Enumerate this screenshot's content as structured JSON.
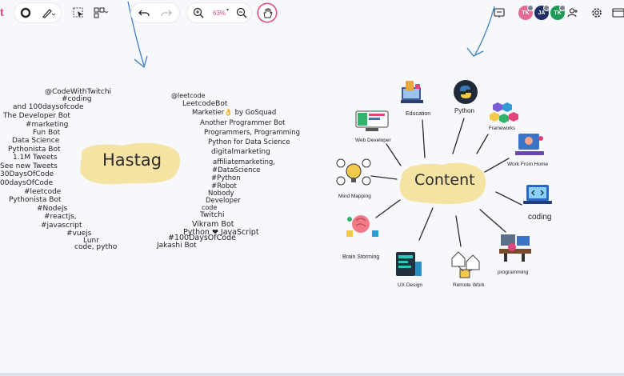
{
  "toolbar": {
    "app_glyph": "t",
    "zoom_level": "63%",
    "zoom_caret": "▾",
    "avatars": [
      {
        "initials": "TK",
        "color": "#e56b96"
      },
      {
        "initials": "JA",
        "color": "#1f2f63"
      },
      {
        "initials": "TK",
        "color": "#1f9b58"
      }
    ],
    "icons": [
      "record-icon",
      "pen-icon",
      "select-icon",
      "shapes-icon",
      "undo-icon",
      "redo-icon",
      "zoom-in-icon",
      "zoom-out-icon",
      "hand-icon",
      "present-icon",
      "add-user-icon",
      "settings-icon",
      "window-icon"
    ]
  },
  "hashtag_map": {
    "center_label": "Hastag",
    "left_items": [
      "@CodeWithTwitchi",
      "#coding",
      "and 100daysofcode",
      "The Developer Bot",
      "#marketing",
      "Fun Bot",
      "Data Science",
      "Pythonista Bot",
      "1.1M Tweets",
      "See new Tweets",
      "30DaysOfCode",
      "00daysOfCode",
      "#leetcode",
      "Pythonista Bot",
      "#Nodejs",
      "#reactjs,",
      "#javascript",
      "#vuejs",
      "Lunr",
      "code, pytho"
    ],
    "right_items": [
      "@leetcode",
      "LeetcodeBot",
      "Marketier👌 by GoSquad",
      "Another Programmer Bot",
      "Programmers, Programming",
      "Python for Data Science",
      "digitalmarketing",
      "affiliatemarketing,",
      "#DataScience",
      "#Python",
      "#Robot",
      "Nobody",
      "Developer",
      "code",
      "Twitchi",
      "Vikram Bot",
      "Python ❤ JavaScript",
      "#100DaysOfCode",
      "Jakashi Bot"
    ]
  },
  "content_map": {
    "center_label": "Content",
    "nodes": [
      {
        "label": "Education",
        "icon": "education-icon"
      },
      {
        "label": "Python",
        "icon": "python-icon"
      },
      {
        "label": "Frameworks",
        "icon": "frameworks-icon"
      },
      {
        "label": "Work From Home",
        "icon": "work-from-home-icon"
      },
      {
        "label": "coding",
        "icon": "coding-icon"
      },
      {
        "label": "programming",
        "icon": "programming-icon"
      },
      {
        "label": "Remote Work",
        "icon": "remote-work-icon"
      },
      {
        "label": "UX Design",
        "icon": "ux-design-icon"
      },
      {
        "label": "Brain Storming",
        "icon": "brain-storming-icon"
      },
      {
        "label": "Mind Mapping",
        "icon": "mind-mapping-icon"
      },
      {
        "label": "Web Developer",
        "icon": "web-developer-icon"
      }
    ]
  },
  "colors": {
    "accent": "#e0457b",
    "highlight": "#f5e3a3",
    "canvas": "#f6f8fc",
    "arrow": "#3b7fc4"
  }
}
